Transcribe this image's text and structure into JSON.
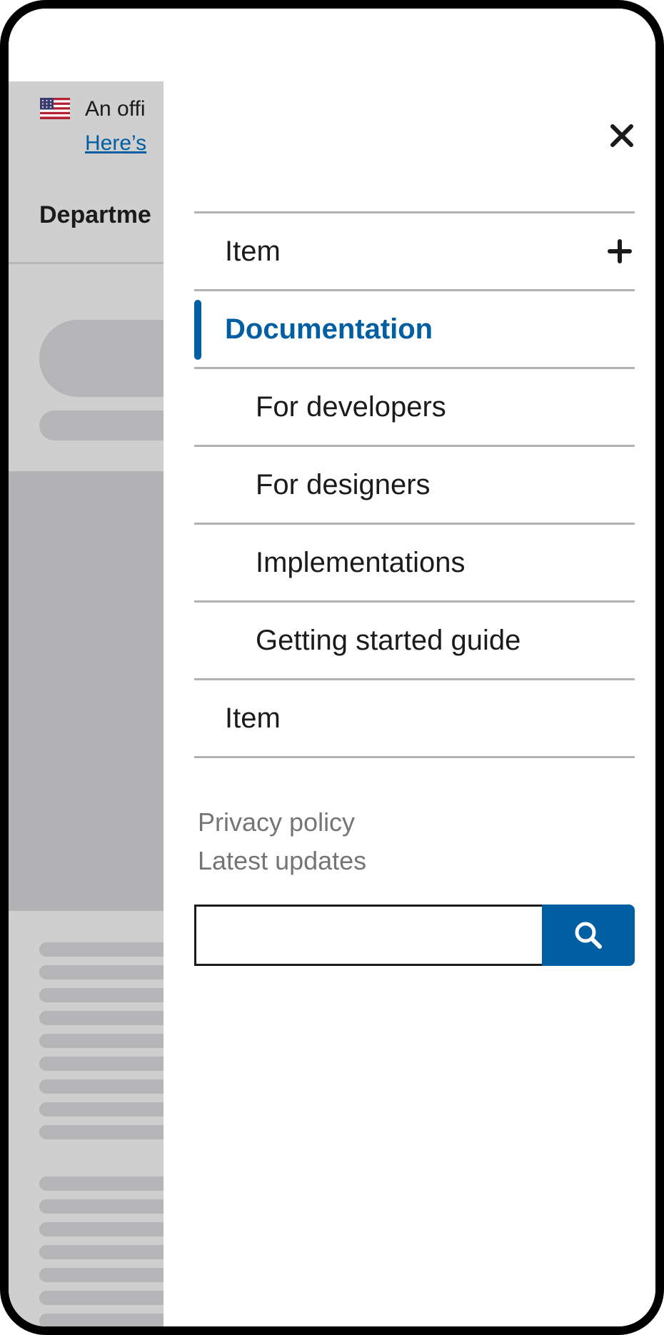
{
  "banner": {
    "text": "An offi",
    "link": "Here’s"
  },
  "header": {
    "title": "Departme"
  },
  "drawer": {
    "close_icon": "close-icon",
    "nav": [
      {
        "label": "Item",
        "expand_icon": "plus-icon"
      },
      {
        "label": "Documentation",
        "current": true
      },
      {
        "label": "For developers",
        "sub": true
      },
      {
        "label": "For designers",
        "sub": true
      },
      {
        "label": "Implementations",
        "sub": true
      },
      {
        "label": "Getting started guide",
        "sub": true
      },
      {
        "label": "Item"
      }
    ],
    "secondary_links": [
      "Privacy policy",
      "Latest updates"
    ],
    "search": {
      "value": "",
      "button_icon": "search-icon"
    }
  },
  "colors": {
    "primary": "#005ea2",
    "overlay_gray": "#cfcfcf",
    "placeholder_gray": "#b5b5b7",
    "divider": "#b2b2b2",
    "muted_text": "#757575"
  }
}
